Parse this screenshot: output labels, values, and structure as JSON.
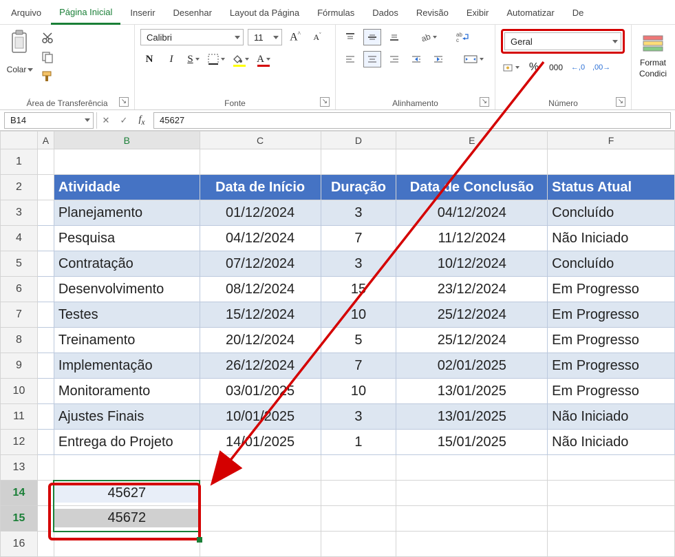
{
  "tabs": {
    "items": [
      "Arquivo",
      "Página Inicial",
      "Inserir",
      "Desenhar",
      "Layout da Página",
      "Fórmulas",
      "Dados",
      "Revisão",
      "Exibir",
      "Automatizar",
      "De"
    ],
    "active_index": 1
  },
  "ribbon": {
    "clipboard": {
      "paste_label": "Colar",
      "group_label": "Área de Transferência"
    },
    "font": {
      "group_label": "Fonte",
      "font_name": "Calibri",
      "font_size": "11",
      "bold": "N",
      "italic": "I",
      "underline": "S",
      "grow": "A",
      "shrink": "A",
      "fill_color": "#ffff00",
      "font_color_swatch": "#d40000"
    },
    "alignment": {
      "group_label": "Alinhamento"
    },
    "number": {
      "group_label": "Número",
      "format": "Geral",
      "pct": "%",
      "thousands": "000",
      "inc_dec": ",0",
      "dec_dec": ",00"
    },
    "styles": {
      "cond_label1": "Format",
      "cond_label2": "Condici"
    }
  },
  "name_box": "B14",
  "formula_bar": "45627",
  "columns": [
    "A",
    "B",
    "C",
    "D",
    "E",
    "F"
  ],
  "table": {
    "headers": [
      "Atividade",
      "Data de Início",
      "Duração",
      "Data de Conclusão",
      "Status Atual"
    ],
    "rows": [
      [
        "Planejamento",
        "01/12/2024",
        "3",
        "04/12/2024",
        "Concluído"
      ],
      [
        "Pesquisa",
        "04/12/2024",
        "7",
        "11/12/2024",
        "Não Iniciado"
      ],
      [
        "Contratação",
        "07/12/2024",
        "3",
        "10/12/2024",
        "Concluído"
      ],
      [
        "Desenvolvimento",
        "08/12/2024",
        "15",
        "23/12/2024",
        "Em Progresso"
      ],
      [
        "Testes",
        "15/12/2024",
        "10",
        "25/12/2024",
        "Em Progresso"
      ],
      [
        "Treinamento",
        "20/12/2024",
        "5",
        "25/12/2024",
        "Em Progresso"
      ],
      [
        "Implementação",
        "26/12/2024",
        "7",
        "02/01/2025",
        "Em Progresso"
      ],
      [
        "Monitoramento",
        "03/01/2025",
        "10",
        "13/01/2025",
        "Em Progresso"
      ],
      [
        "Ajustes Finais",
        "10/01/2025",
        "3",
        "13/01/2025",
        "Não Iniciado"
      ],
      [
        "Entrega do Projeto",
        "14/01/2025",
        "1",
        "15/01/2025",
        "Não Iniciado"
      ]
    ]
  },
  "selected_values": {
    "b14": "45627",
    "b15": "45672"
  }
}
